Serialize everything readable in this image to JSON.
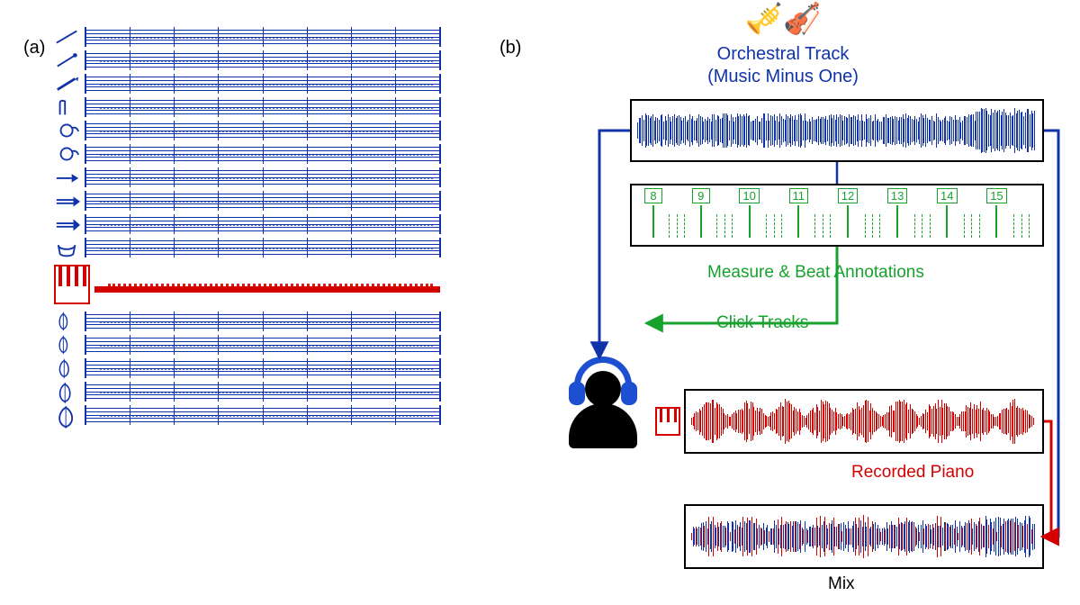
{
  "panels": {
    "a_label": "(a)",
    "b_label": "(b)"
  },
  "orchestral_track": {
    "title": "Orchestral Track\n(Music Minus One)",
    "icon_name": "orchestra-instruments-icon"
  },
  "measure_beat_label": "Measure & Beat Annotations",
  "click_tracks_label": "Click Tracks",
  "recorded_piano_label": "Recorded Piano",
  "mix_label": "Mix",
  "beat_numbers": [
    "8",
    "9",
    "10",
    "11",
    "12",
    "13",
    "14",
    "15"
  ],
  "subdivisions_per_measure": 3,
  "colors": {
    "orchestra": "#1133aa",
    "piano": "#d40000",
    "annotations": "#17a22e",
    "headphones": "#1d4fd1"
  },
  "score": {
    "orchestra_top_instruments": [
      "flute",
      "oboe",
      "clarinet",
      "bassoon",
      "horn1",
      "horn2",
      "trumpet",
      "trombone",
      "trombone-bass",
      "timpani"
    ],
    "piano_staves": 2,
    "orchestra_bottom_instruments": [
      "violin1",
      "violin2",
      "viola",
      "cello",
      "bass"
    ],
    "measures_shown": 8
  },
  "flow_edges": [
    {
      "from": "orchestral-waveform-box",
      "to": "listener-icon",
      "color": "orchestra"
    },
    {
      "from": "orchestral-waveform-box",
      "to": "measure-beat-box",
      "color": "orchestra"
    },
    {
      "from": "measure-beat-box",
      "to": "listener-icon",
      "label": "click_tracks_label",
      "color": "annotations"
    },
    {
      "from": "orchestral-waveform-box",
      "to": "mix-box",
      "color": "orchestra"
    },
    {
      "from": "recorded-piano-box",
      "to": "mix-box",
      "color": "piano"
    }
  ]
}
